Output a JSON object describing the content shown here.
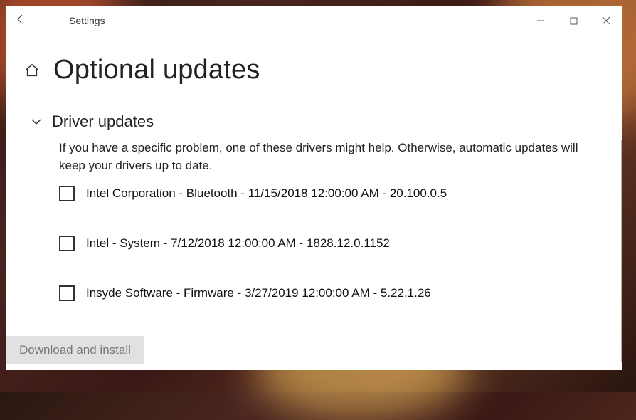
{
  "window": {
    "title": "Settings"
  },
  "page": {
    "title": "Optional updates"
  },
  "section": {
    "title": "Driver updates",
    "description": "If you have a specific problem, one of these drivers might help. Otherwise, automatic updates will keep your drivers up to date."
  },
  "drivers": {
    "items": [
      {
        "label": "Intel Corporation - Bluetooth - 11/15/2018 12:00:00 AM - 20.100.0.5",
        "checked": false
      },
      {
        "label": "Intel - System - 7/12/2018 12:00:00 AM - 1828.12.0.1152",
        "checked": false
      },
      {
        "label": "Insyde Software - Firmware - 3/27/2019 12:00:00 AM - 5.22.1.26",
        "checked": false
      }
    ]
  },
  "actions": {
    "download_label": "Download and install"
  },
  "icons": {
    "back": "←",
    "home": "⌂",
    "chevron_down": "⌄",
    "minimize": "—",
    "maximize": "□",
    "close": "✕"
  }
}
